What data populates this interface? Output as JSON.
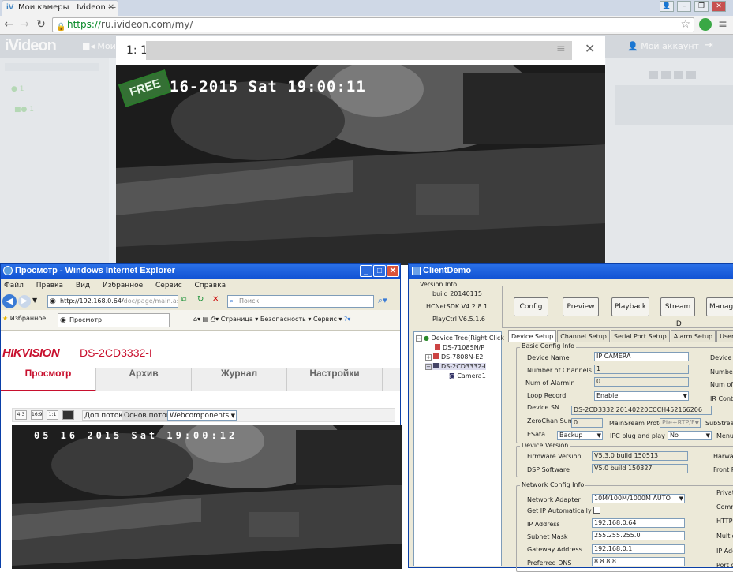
{
  "chrome": {
    "tab_title": "Мои камеры | Ivideon — Ви...",
    "url_scheme": "https://",
    "url_rest": "ru.ivideon.com/my/"
  },
  "ivideon": {
    "logo": "iVideon",
    "nav_cams": "Мои",
    "account": "Мой аккаунт",
    "sidebar_items": [
      "1",
      "1"
    ]
  },
  "modal": {
    "title": "1: 1",
    "osd": "16-2015 Sat 19:00:11",
    "stamp": "FREE"
  },
  "ie": {
    "title": "Просмотр - Windows Internet Explorer",
    "menu": [
      "Файл",
      "Правка",
      "Вид",
      "Избранное",
      "Сервис",
      "Справка"
    ],
    "address_host": "http://192.168.0.64/",
    "address_path": "doc/page/main.as",
    "search_placeholder": "Поиск",
    "favorites": "Избранное",
    "tab": "Просмотр",
    "cmd_page": "Страница",
    "cmd_security": "Безопасность",
    "cmd_service": "Сервис"
  },
  "hikvision": {
    "logo": "HIKVISION",
    "model": "DS-2CD3332-I",
    "tabs": [
      "Просмотр",
      "Архив",
      "Журнал",
      "Настройки"
    ],
    "toolbar": {
      "icon1": "4:3",
      "icon2": "16:9",
      "icon3": "1:1",
      "additional_stream": "Доп поток",
      "main_stream": "Основ.поток",
      "plugin_select": "Webcomponents"
    },
    "osd": "05 16 2015 Sat 19:00:12"
  },
  "clientdemo": {
    "title": "ClientDemo",
    "version_info": "Version Info",
    "build": "build 20140115",
    "sdk": "HCNetSDK V4.2.8.1",
    "playctrl": "PlayCtrl V6.5.1.6",
    "tree_header": "Device Tree(Right Click",
    "tree": [
      "DS-7108SN/P",
      "DS-7808N-E2",
      "DS-2CD3332-I",
      "Camera1"
    ],
    "buttons": [
      "Config",
      "Preview",
      "Playback",
      "Stream ID",
      "Managem"
    ],
    "tabs": [
      "Device Setup",
      "Channel Setup",
      "Serial Port Setup",
      "Alarm Setup",
      "User Setup",
      "E"
    ],
    "basic_title": "Basic Config Info",
    "device_name_label": "Device Name",
    "device_name": "IP CAMERA",
    "channels_label": "Number of Channels",
    "channels": "1",
    "alarmin_label": "Num of AlarmIn",
    "alarmin": "0",
    "loop_label": "Loop Record",
    "loop": "Enable",
    "sn_label": "Device SN",
    "sn": "DS-2CD3332I20140220CCCH452166206",
    "zerochan_label": "ZeroChan Sum",
    "zerochan": "0",
    "mainstream_label": "MainSream Proto",
    "mainstream": "Pte+RTP/F",
    "substream_label": "SubStrean",
    "esata_label": "ESata",
    "esata": "Backup",
    "ipc_label": "IPC plug and play",
    "ipc": "No",
    "menu_label": "Menu",
    "right_col1": [
      "Device",
      "Number",
      "Num of A",
      "IR Contr"
    ],
    "dev_version_title": "Device Version",
    "firmware_label": "Firmware Version",
    "firmware": "V5.3.0 build 150513",
    "dsp_label": "DSP Software",
    "dsp": "V5.0 build 150327",
    "right_col2": [
      "Harwar",
      "Front P"
    ],
    "net_title": "Network Config Info",
    "adapter_label": "Network Adapter",
    "adapter": "10M/100M/1000M AUTO",
    "getip_label": "Get IP Automatically",
    "ip_label": "IP Address",
    "ip": "192.168.0.64",
    "mask_label": "Subnet Mask",
    "mask": "255.255.255.0",
    "gw_label": "Gateway Address",
    "gw": "192.168.0.1",
    "dns_label": "Preferred DNS",
    "dns": "8.8.8.8",
    "right_col3": [
      "Private",
      "Comm",
      "HTTP",
      "Multica",
      "IP Add",
      "Port of"
    ]
  }
}
